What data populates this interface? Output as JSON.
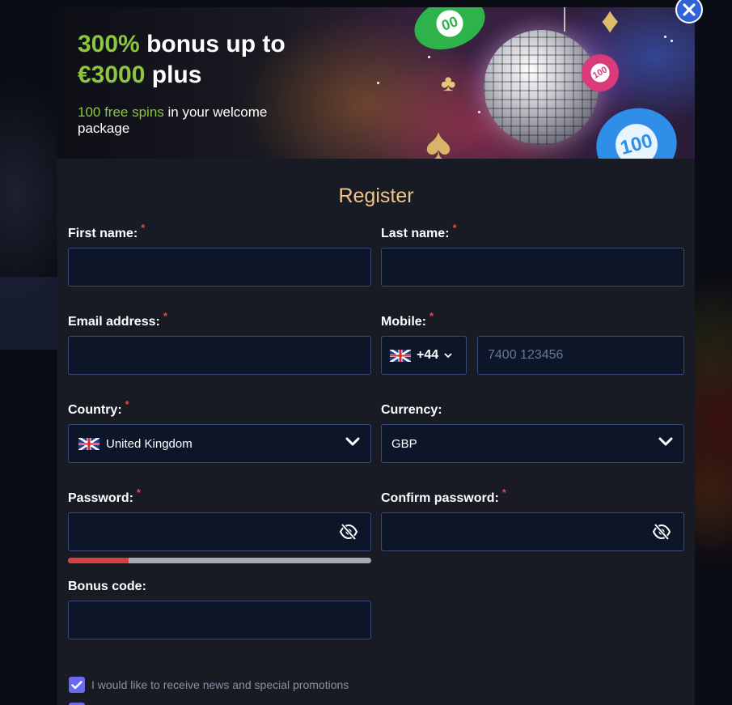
{
  "banner": {
    "title_highlight_1": "300%",
    "title_text_1": " bonus up to",
    "title_highlight_2": "€3000",
    "title_text_2": " plus",
    "sub_highlight": "100 free spins",
    "sub_text": " in your welcome package",
    "chip_green_label": "00",
    "chip_blue_label": "100",
    "chip_pink_label": "100"
  },
  "form": {
    "title": "Register",
    "required_mark": "*",
    "first_name": {
      "label": "First name:",
      "value": "",
      "placeholder": ""
    },
    "last_name": {
      "label": "Last name:",
      "value": "",
      "placeholder": ""
    },
    "email": {
      "label": "Email address:",
      "value": "",
      "placeholder": ""
    },
    "mobile": {
      "label": "Mobile:",
      "dial_code": "+44",
      "value": "",
      "placeholder": "7400 123456"
    },
    "country": {
      "label": "Country:",
      "selected": "United Kingdom"
    },
    "currency": {
      "label": "Currency:",
      "selected": "GBP"
    },
    "password": {
      "label": "Password:",
      "value": "",
      "strength": 0.2
    },
    "confirm_password": {
      "label": "Confirm password:",
      "value": ""
    },
    "bonus_code": {
      "label": "Bonus code:",
      "value": ""
    },
    "newsletter": {
      "label": "I would like to receive news and special promotions",
      "checked": true
    }
  },
  "colors": {
    "accent_green": "#8cc63f",
    "title_gold": "#f1c48a",
    "required_red": "#e04a4a",
    "field_bg": "#0d1628",
    "field_border": "#3a4a78",
    "checkbox": "#6a6af0",
    "close_button": "#2f64d8"
  },
  "icons": {
    "close": "close-icon",
    "flag": "uk-flag-icon",
    "chevron": "chevron-down-icon",
    "eye_off": "eye-off-icon",
    "check": "check-icon"
  }
}
